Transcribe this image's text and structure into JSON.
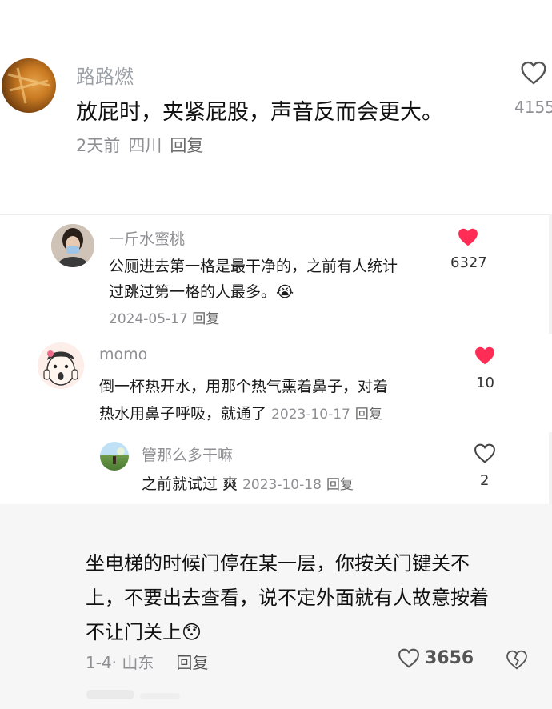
{
  "comment1": {
    "author": "路路燃",
    "text": "放屁时，夹紧屁股，声音反而会更大。",
    "meta": {
      "time": "2天前",
      "location": "四川",
      "reply": "回复"
    },
    "likes": "4155"
  },
  "comment2": {
    "author": "一斤水蜜桃",
    "line1": "公厕进去第一格是最干净的，之前有人统计",
    "line2": "过跳过第一格的人最多。",
    "emoji": "😭",
    "date": "2024-05-17",
    "reply": "回复",
    "likes": "6327"
  },
  "comment3": {
    "author": "momo",
    "line1": "倒一杯热开水，用那个热气熏着鼻子，对着",
    "line2": "热水用鼻子呼吸，就通了",
    "date": "2023-10-17",
    "reply": "回复",
    "likes": "10"
  },
  "comment4": {
    "author": "管那么多干嘛",
    "text": "之前就试过 爽",
    "date": "2023-10-18",
    "reply": "回复",
    "likes": "2"
  },
  "comment5": {
    "line1": "坐电梯的时候门停在某一层，你按关门键关不",
    "line2": "上，不要出去查看，说不定外面就有人故意按着",
    "line3": "不让门关上",
    "emoji": "😯",
    "meta": {
      "date": "1-4",
      "location": "山东",
      "reply": "回复"
    },
    "likes": "3656"
  },
  "colors": {
    "liked": "#ff2d55",
    "gray": "#8e8e93"
  }
}
